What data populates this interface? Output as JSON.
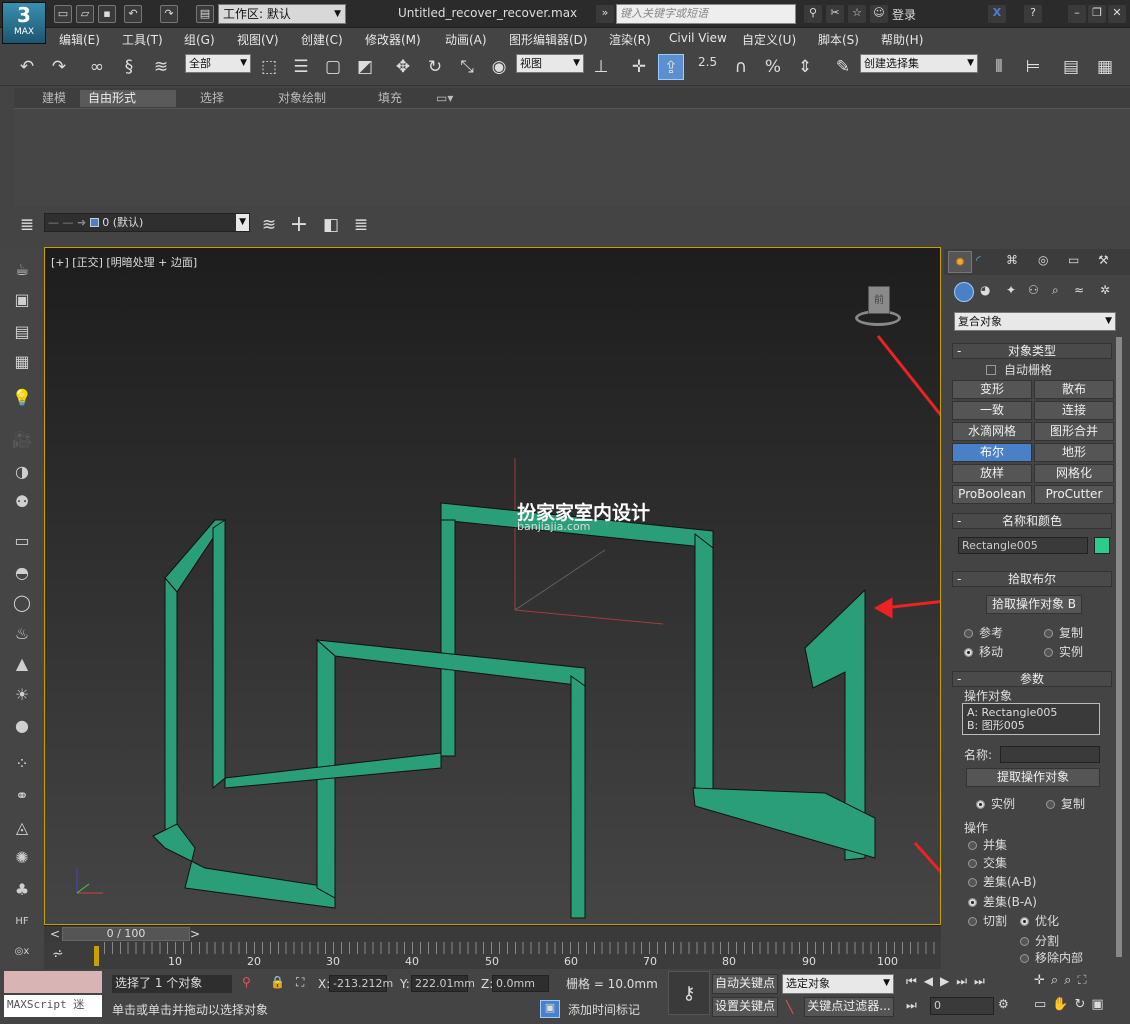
{
  "app": {
    "logo_text": "MAX",
    "title": "Untitled_recover_recover.max",
    "workspace": "工作区: 默认",
    "search_placeholder": "键入关键字或短语",
    "login": "登录"
  },
  "menu": [
    "编辑(E)",
    "工具(T)",
    "组(G)",
    "视图(V)",
    "创建(C)",
    "修改器(M)",
    "动画(A)",
    "图形编辑器(D)",
    "渲染(R)",
    "Civil View",
    "自定义(U)",
    "脚本(S)",
    "帮助(H)"
  ],
  "toolbar": {
    "selection_filter": "全部",
    "ref_coord": "视图",
    "named_selection": "创建选择集",
    "snap_angle_label": "2.5"
  },
  "ribbon": {
    "tabs": [
      "建模",
      "自由形式",
      "选择",
      "对象绘制",
      "填充"
    ],
    "active_tab": "自由形式"
  },
  "layer": {
    "current": "0 (默认)"
  },
  "viewport": {
    "label": "[+] [正交] [明暗处理 + 边面]",
    "watermark_cn": "扮家家室内设计",
    "watermark_en": "banjiajia.com",
    "object_color": "#2a9e78"
  },
  "command_panel": {
    "category": "复合对象",
    "object_type_title": "对象类型",
    "autogrid": "自动栅格",
    "buttons": [
      "变形",
      "散布",
      "一致",
      "连接",
      "水滴网格",
      "图形合并",
      "布尔",
      "地形",
      "放样",
      "网格化",
      "ProBoolean",
      "ProCutter"
    ],
    "active_button": "布尔",
    "name_color_title": "名称和颜色",
    "object_name": "Rectangle005",
    "object_color": "#2ecc8a",
    "pick_boolean_title": "拾取布尔",
    "pick_operand_b": "拾取操作对象 B",
    "pick_options": [
      "参考",
      "复制",
      "移动",
      "实例"
    ],
    "params_title": "参数",
    "operands_label": "操作对象",
    "operand_a": "A: Rectangle005",
    "operand_b": "B: 图形005",
    "name_label": "名称:",
    "extract_operand": "提取操作对象",
    "extract_options": [
      "实例",
      "复制"
    ],
    "operation_label": "操作",
    "operations": [
      "并集",
      "交集",
      "差集(A-B)",
      "差集(B-A)",
      "切割"
    ],
    "cut_options": [
      "优化",
      "分割",
      "移除内部"
    ]
  },
  "timeline": {
    "frame": "0 / 100",
    "ticks": [
      "10",
      "20",
      "30",
      "40",
      "50",
      "60",
      "70",
      "80",
      "90",
      "100"
    ]
  },
  "status": {
    "maxscript": "MAXScript 迷",
    "selection": "选择了 1 个对象",
    "prompt": "单击或单击并拖动以选择对象",
    "x_label": "X:",
    "x_value": "-213.212m",
    "y_label": "Y:",
    "y_value": "222.01mm",
    "z_label": "Z:",
    "z_value": "0.0mm",
    "grid": "栅格 = 10.0mm",
    "add_time_tag": "添加时间标记",
    "auto_key": "自动关键点",
    "set_key": "设置关键点",
    "key_mode": "选定对象",
    "key_filters": "关键点过滤器...",
    "current_frame": "0"
  }
}
